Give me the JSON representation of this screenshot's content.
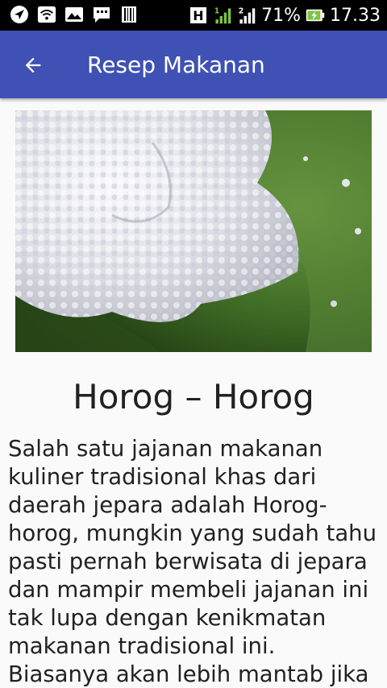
{
  "status_bar": {
    "battery_percent": "71%",
    "time": "17.33",
    "icons": [
      "navigation-icon",
      "wifi-icon",
      "image-icon",
      "chat-icon",
      "barcode-icon",
      "h-signal-icon",
      "signal-1-icon",
      "signal-2-icon",
      "battery-charging-icon"
    ],
    "sim1_label": "H",
    "sim1_index": "1",
    "sim2_index": "2"
  },
  "app_bar": {
    "title": "Resep Makanan",
    "back_icon": "arrow-back-icon",
    "color": "#3f51b5"
  },
  "recipe": {
    "image_icon": "food-photo",
    "title": "Horog – Horog",
    "description": "Salah satu jajanan makanan kuliner tradisional khas dari daerah jepara adalah Horog-horog, mungkin yang sudah tahu pasti pernah berwisata di jepara dan mampir membeli jajanan ini tak lupa dengan kenikmatan makanan tradisional ini.\nBiasanya akan lebih mantab jika"
  }
}
